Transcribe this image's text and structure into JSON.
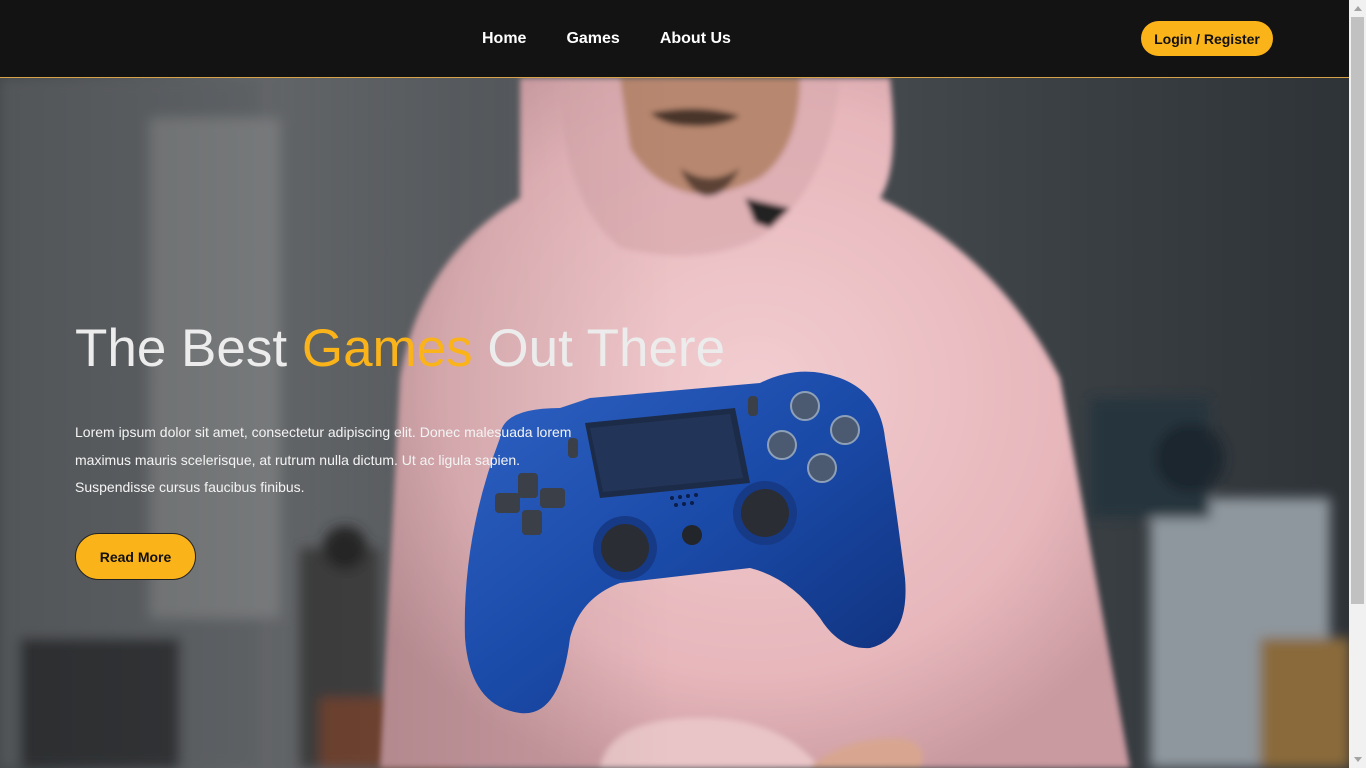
{
  "nav": {
    "items": [
      {
        "label": "Home"
      },
      {
        "label": "Games"
      },
      {
        "label": "About Us"
      }
    ],
    "login_label": "Login / Register"
  },
  "hero": {
    "title_before": "The Best ",
    "title_accent": "Games",
    "title_after": " Out There",
    "paragraph": "Lorem ipsum dolor sit amet, consectetur adipiscing elit. Donec malesuada lorem maximus mauris scelerisque, at rutrum nulla dictum. Ut ac ligula sapien. Suspendisse cursus faucibus finibus.",
    "button_label": "Read More"
  },
  "colors": {
    "accent": "#fbb31a",
    "header_bg": "#131313",
    "text_light": "#ececec"
  },
  "icons": {
    "hero_image": "gamer-holding-controller-photo"
  }
}
